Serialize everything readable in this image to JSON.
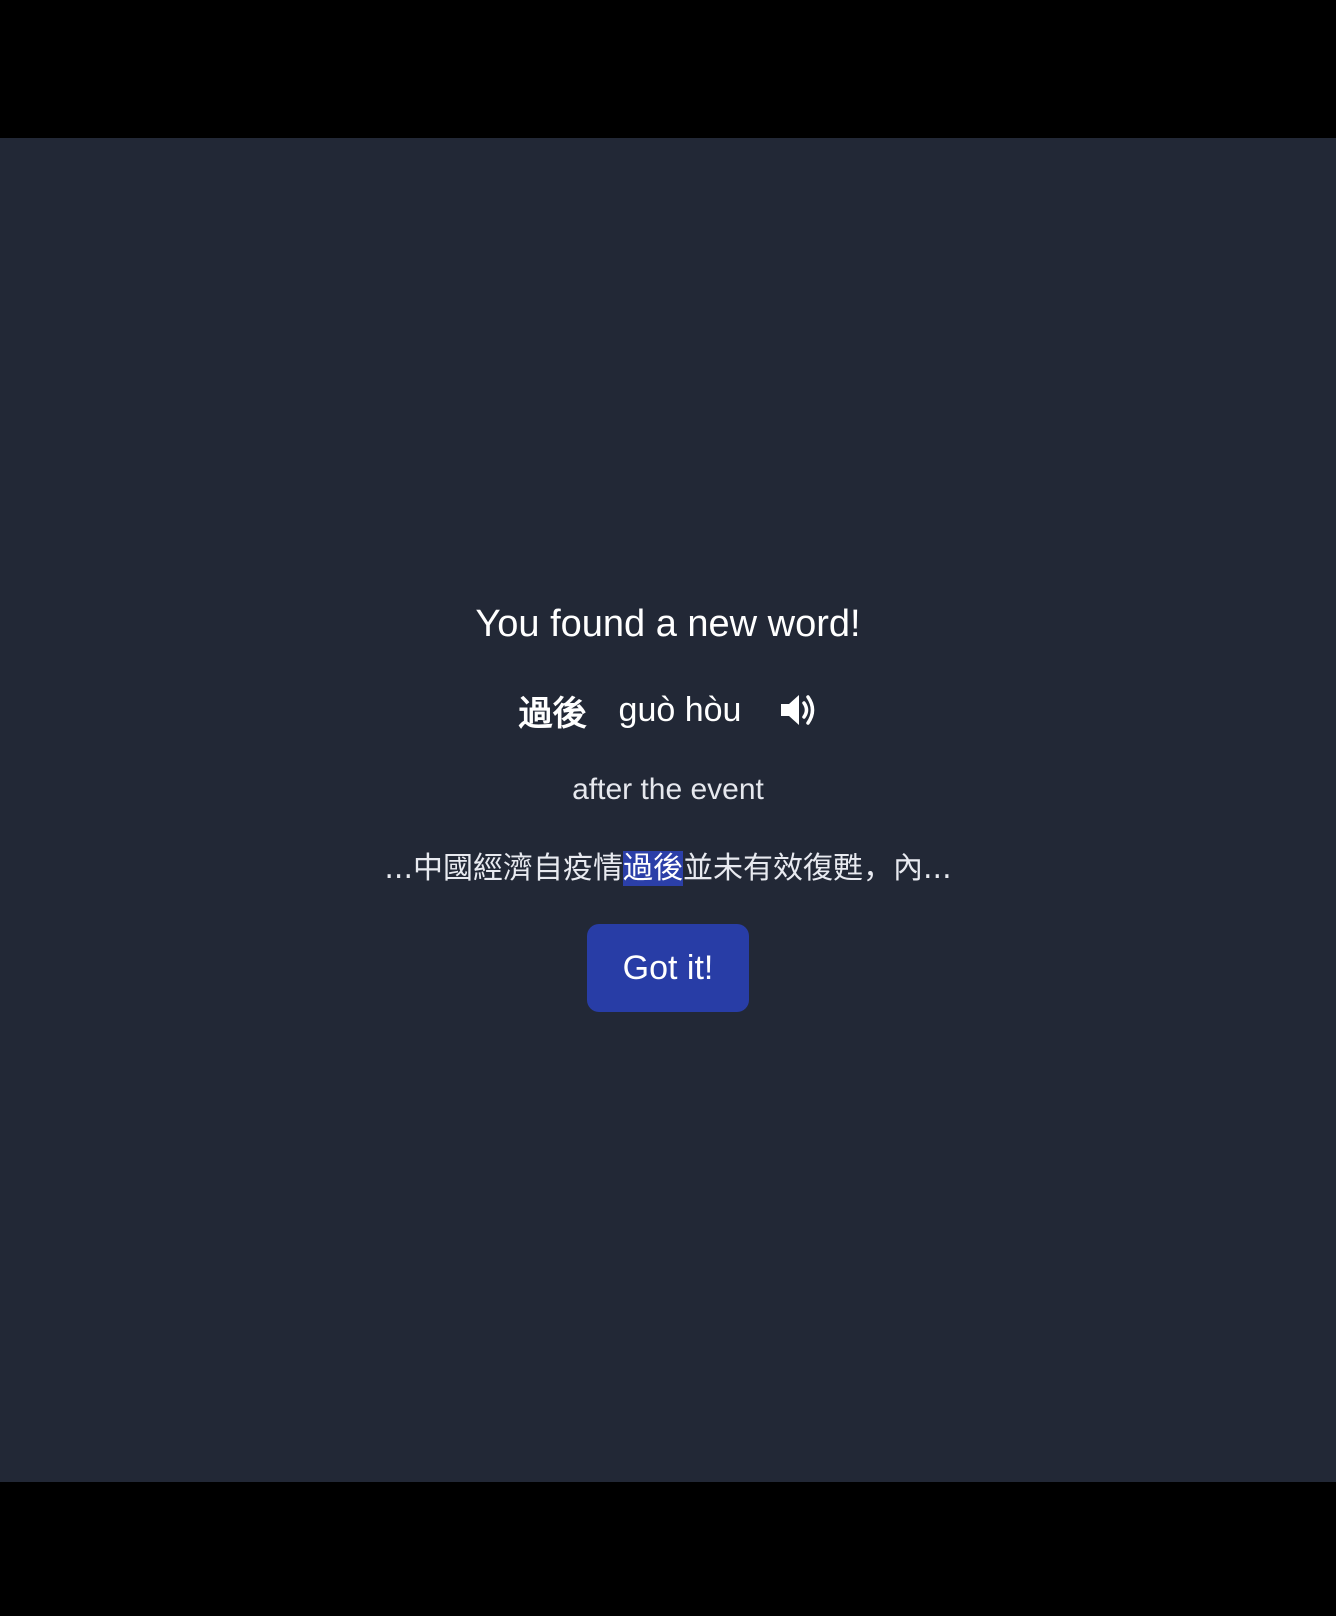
{
  "dialog": {
    "headline": "You found a new word!",
    "word": {
      "hanzi": "過後",
      "pinyin": "guò hòu",
      "audio_icon": "speaker-icon"
    },
    "meaning": "after the event",
    "example": {
      "before": "...中國經濟自疫情",
      "highlight": "過後",
      "after": "並未有效復甦，內..."
    },
    "confirm_label": "Got it!"
  },
  "colors": {
    "background": "#222836",
    "accent": "#283da6",
    "highlight": "#2b3fa8",
    "text": "#ffffff"
  }
}
